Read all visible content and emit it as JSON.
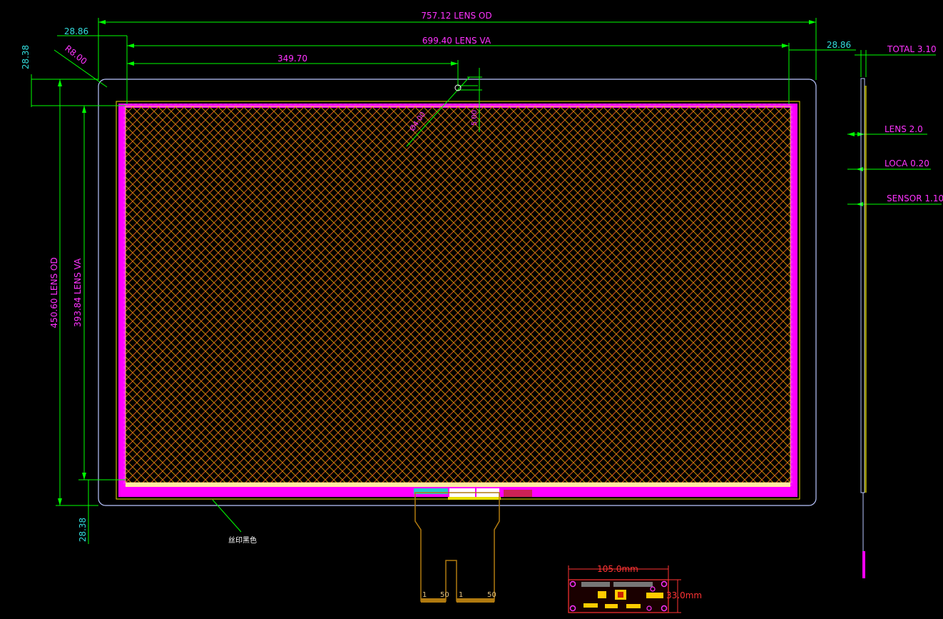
{
  "colors": {
    "background": "#000000",
    "dimension_line": "#00ff00",
    "text_magenta": "#ff33ff",
    "text_cyan": "#33dddd",
    "outline": "#b9c6ff",
    "silkscreen": "#ff00ff",
    "grid_a": "#c49000",
    "grid_b": "#d85a20",
    "fpc": "#b07a10"
  },
  "dims": {
    "lens_od_width": "757.12 LENS OD",
    "lens_va_width": "699.40 LENS VA",
    "half_width": "349.70",
    "margin_left": "28.86",
    "margin_right": "28.86",
    "margin_top": "28.38",
    "margin_bottom": "28.38",
    "corner_radius": "R8.00",
    "lens_od_height": "450.60 LENS OD",
    "lens_va_height": "393.84 LENS VA",
    "hole_dia": "Ø4.00",
    "hole_offset": "5.00"
  },
  "stack": {
    "total": "TOTAL 3.10",
    "lens": "LENS 2.0",
    "loca": "LOCA 0.20",
    "sensor": "SENSOR 1.10"
  },
  "notes": {
    "silkscreen_note": "丝印黑色"
  },
  "fpc": {
    "pin_left_1": "1",
    "pin_left_50": "50",
    "pin_right_1": "1",
    "pin_right_50": "50"
  },
  "pcb": {
    "width": "105.0mm",
    "height": "33.0mm"
  }
}
